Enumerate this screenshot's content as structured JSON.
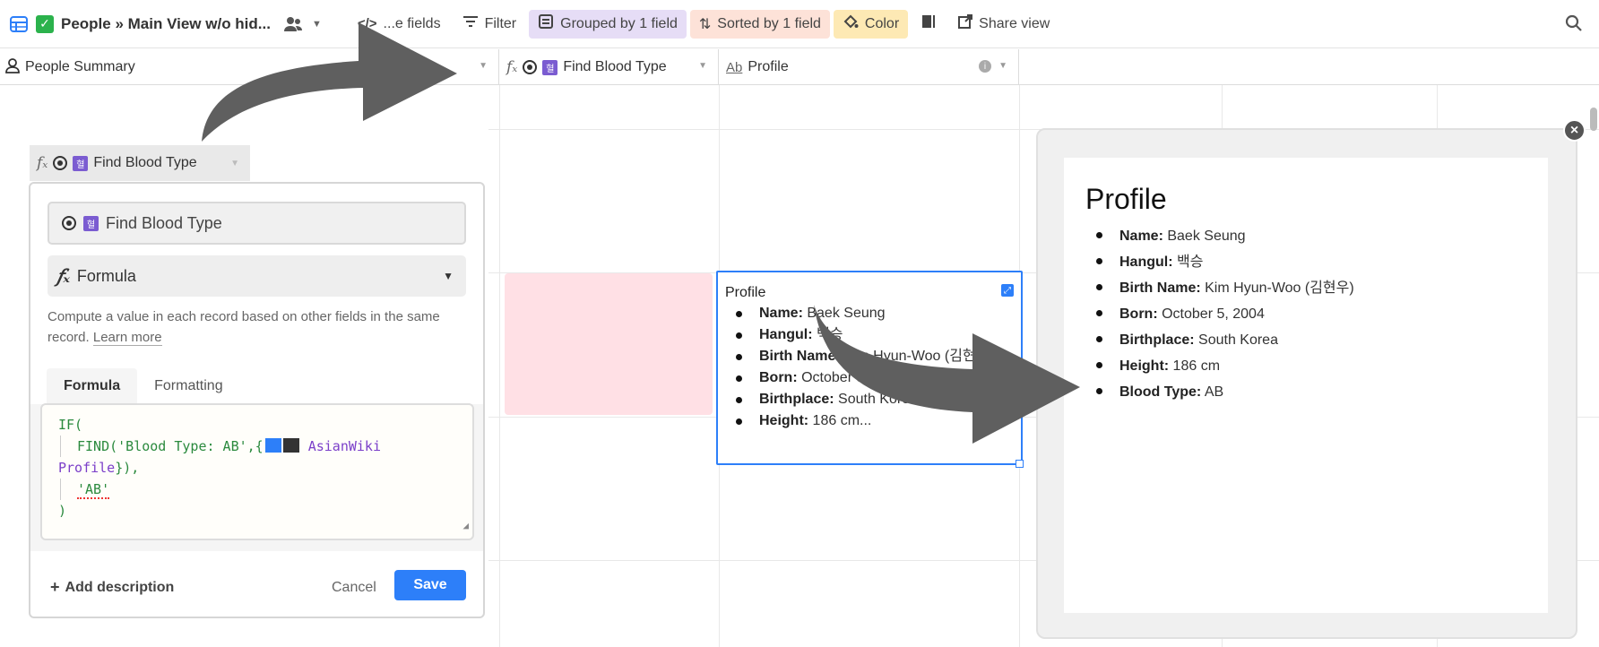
{
  "toolbar": {
    "view_name": "People » Main View w/o hid...",
    "hide_fields_label": "...e fields",
    "filter_label": "Filter",
    "group_label": "Grouped by 1 field",
    "sort_label": "Sorted by 1 field",
    "color_label": "Color",
    "share_label": "Share view",
    "colors": {
      "group_bg": "#e6ddf6",
      "sort_bg": "#fde2d8",
      "color_bg": "#fde9b4"
    }
  },
  "columns": {
    "people_summary": "People Summary",
    "find_blood_type": "Find Blood Type",
    "profile": "Profile"
  },
  "drag_header": {
    "label": "Find Blood Type"
  },
  "field_editor": {
    "field_name": "Find Blood Type",
    "field_type": "Formula",
    "description": "Compute a value in each record based on other fields in the same record.",
    "learn_more": "Learn more",
    "tabs": [
      "Formula",
      "Formatting"
    ],
    "code": {
      "line1": "IF(",
      "line2_fn": "FIND('Blood Type: AB',{",
      "line2_ref": "AsianWiki",
      "line3_ref": "Profile",
      "line3_end": "}),",
      "line4": "'AB'",
      "line5": ")"
    },
    "add_description": "Add description",
    "cancel": "Cancel",
    "save": "Save",
    "accent": "#2d7ff9"
  },
  "cell_profile": {
    "title": "Profile",
    "items": [
      {
        "key": "Name:",
        "val": " Baek Seung"
      },
      {
        "key": "Hangul:",
        "val": " 백승"
      },
      {
        "key": "Birth Name:",
        "val": " Kim Hyun-Woo (김현우)"
      },
      {
        "key": "Born:",
        "val": " October 5, 2004"
      },
      {
        "key": "Birthplace:",
        "val": " South Korea"
      },
      {
        "key": "Height:",
        "val": " 186 cm..."
      }
    ]
  },
  "expanded_profile": {
    "title": "Profile",
    "items": [
      {
        "key": "Name:",
        "val": " Baek Seung"
      },
      {
        "key": "Hangul:",
        "val": " 백승"
      },
      {
        "key": "Birth Name:",
        "val": " Kim Hyun-Woo (김현우)"
      },
      {
        "key": "Born:",
        "val": " October 5, 2004"
      },
      {
        "key": "Birthplace:",
        "val": " South Korea"
      },
      {
        "key": "Height:",
        "val": " 186 cm"
      },
      {
        "key": "Blood Type:",
        "val": " AB"
      }
    ]
  }
}
